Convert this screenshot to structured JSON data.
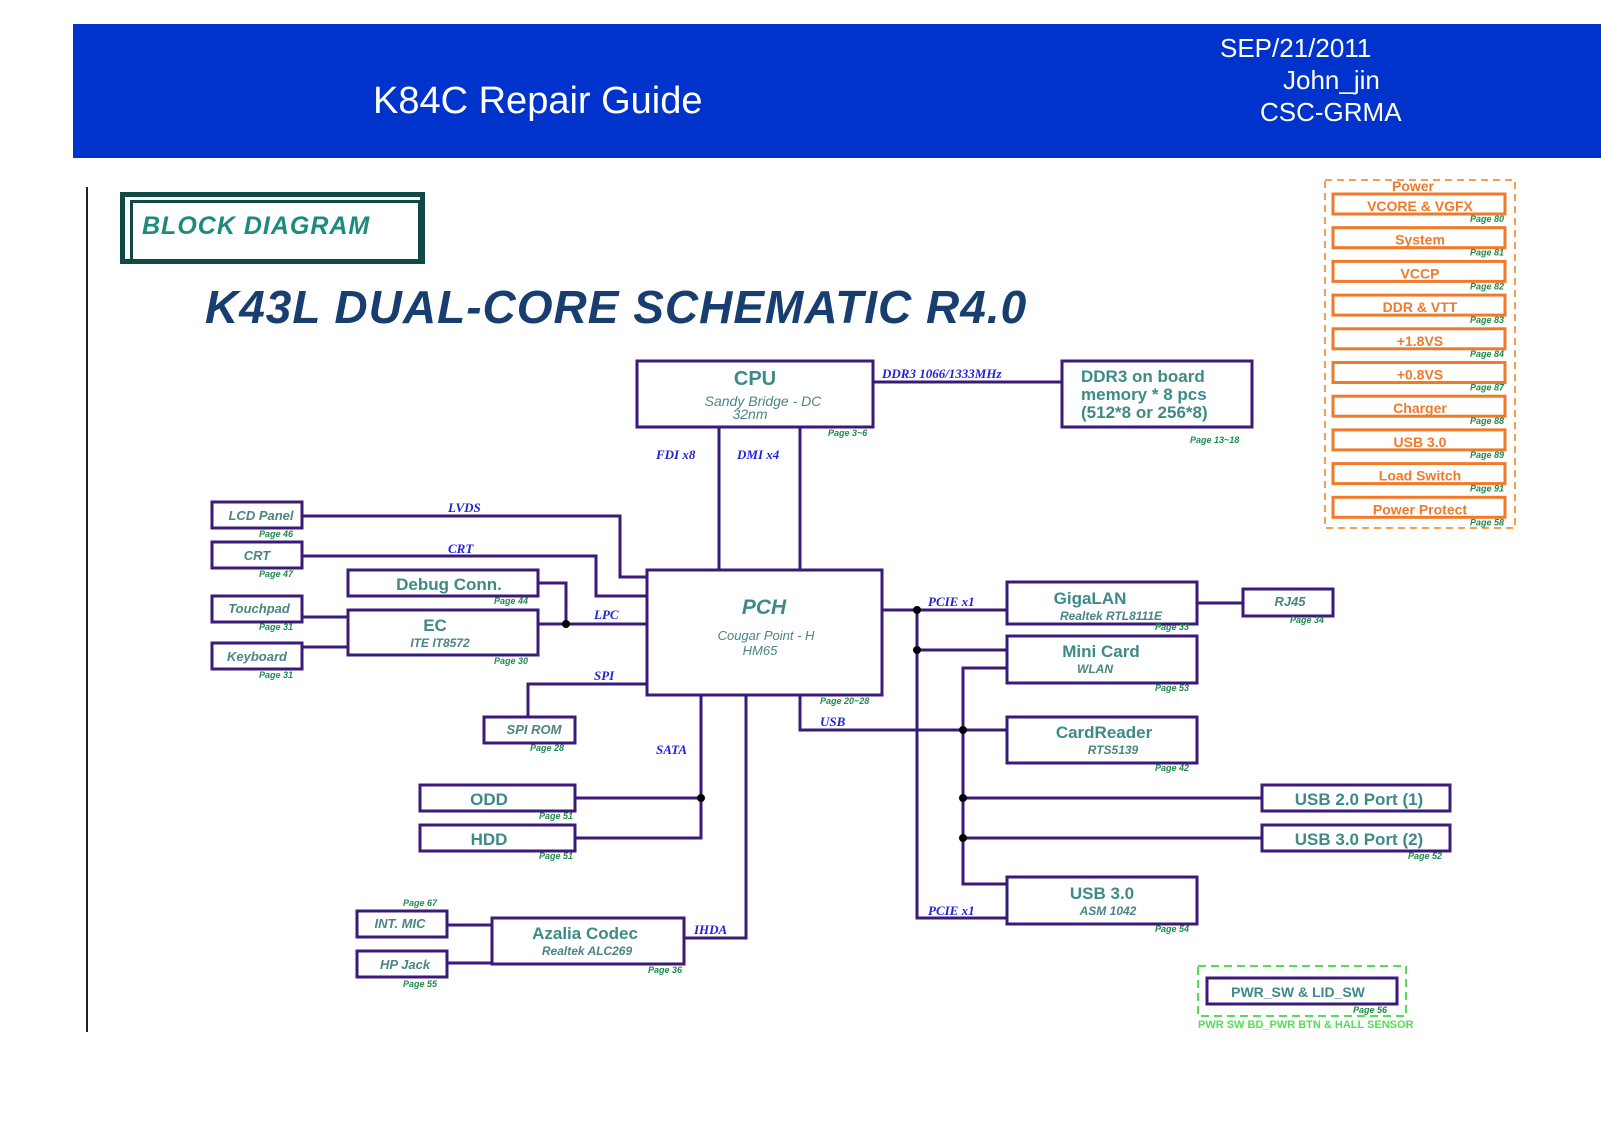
{
  "header": {
    "title": "K84C Repair Guide",
    "date": "SEP/21/2011",
    "author": "John_jin",
    "department": "CSC-GRMA"
  },
  "block_label": "BLOCK DIAGRAM",
  "diagram_title": "K43L DUAL-CORE SCHEMATIC R4.0",
  "colors": {
    "header_bg": "#0033cc",
    "box_border": "#3b1a7a",
    "bus_label": "#2222dd",
    "page_label": "#1f8a4c",
    "power_orange": "#f07a2a",
    "power_switch_dashed": "#55dd55"
  },
  "blocks": {
    "cpu": {
      "title": "CPU",
      "sub1": "Sandy Bridge - DC",
      "sub2": "32nm",
      "page": "Page 3~6"
    },
    "ddr3": {
      "line1": "DDR3 on board",
      "line2": "memory * 8 pcs",
      "line3": "(512*8 or 256*8)",
      "page": "Page 13~18"
    },
    "pch": {
      "title": "PCH",
      "sub1": "Cougar Point - H",
      "sub2": "HM65",
      "page": "Page 20~28"
    },
    "lcd": {
      "title": "LCD Panel",
      "page": "Page 46"
    },
    "crt": {
      "title": "CRT",
      "page": "Page 47"
    },
    "debug": {
      "title": "Debug Conn.",
      "page": "Page 44"
    },
    "touchpad": {
      "title": "Touchpad",
      "page": "Page 31"
    },
    "ec": {
      "title": "EC",
      "sub1": "ITE IT8572",
      "page": "Page 30"
    },
    "keyboard": {
      "title": "Keyboard",
      "page": "Page 31"
    },
    "spirom": {
      "title": "SPI ROM",
      "page": "Page 28"
    },
    "odd": {
      "title": "ODD",
      "page": "Page 51"
    },
    "hdd": {
      "title": "HDD",
      "page": "Page 51"
    },
    "intmic": {
      "title": "INT. MIC",
      "page": "Page 67"
    },
    "hpjack": {
      "title": "HP Jack",
      "page": "Page 55"
    },
    "azalia": {
      "title": "Azalia Codec",
      "sub1": "Realtek ALC269",
      "page": "Page 36"
    },
    "gigalan": {
      "title": "GigaLAN",
      "sub1": "Realtek RTL8111E",
      "page": "Page 33"
    },
    "rj45": {
      "title": "RJ45",
      "page": "Page 34"
    },
    "minicard": {
      "title": "Mini Card",
      "sub1": "WLAN",
      "page": "Page 53"
    },
    "cardreader": {
      "title": "CardReader",
      "sub1": "RTS5139",
      "page": "Page 42"
    },
    "usb2port": {
      "title": "USB 2.0 Port (1)"
    },
    "usb3port": {
      "title": "USB 3.0 Port (2)",
      "page": "Page 52"
    },
    "usb3": {
      "title": "USB 3.0",
      "sub1": "ASM 1042",
      "page": "Page 54"
    },
    "pwrsw": {
      "title": "PWR_SW & LID_SW",
      "page": "Page 56",
      "caption": "PWR SW BD_PWR BTN & HALL SENSOR"
    }
  },
  "buses": {
    "ddr3": "DDR3 1066/1333MHz",
    "fdi": "FDI x8",
    "dmi": "DMI x4",
    "lvds": "LVDS",
    "crt": "CRT",
    "lpc": "LPC",
    "spi": "SPI",
    "sata": "SATA",
    "ihda": "IHDA",
    "usb": "USB",
    "pcie1": "PCIE x1",
    "pcie2": "PCIE x1"
  },
  "power": {
    "heading": "Power",
    "items": [
      {
        "label": "VCORE & VGFX",
        "page": "Page 80"
      },
      {
        "label": "System",
        "page": "Page 81"
      },
      {
        "label": "VCCP",
        "page": "Page 82"
      },
      {
        "label": "DDR & VTT",
        "page": "Page 83"
      },
      {
        "label": "+1.8VS",
        "page": "Page 84"
      },
      {
        "label": "+0.8VS",
        "page": "Page 87"
      },
      {
        "label": "Charger",
        "page": "Page 88"
      },
      {
        "label": "USB 3.0",
        "page": "Page 89"
      },
      {
        "label": "Load Switch",
        "page": "Page 91"
      },
      {
        "label": "Power Protect",
        "page": "Page 58"
      }
    ]
  }
}
